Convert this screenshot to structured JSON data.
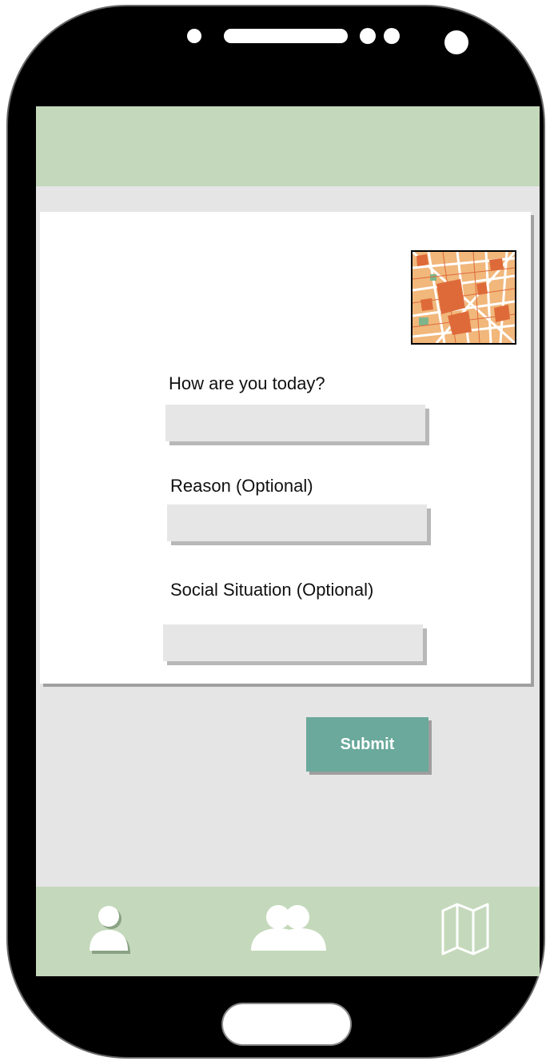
{
  "form": {
    "mood_label": "How are you today?",
    "mood_value": "",
    "reason_label": "Reason (Optional)",
    "reason_value": "",
    "social_label": "Social Situation (Optional)",
    "social_value": ""
  },
  "submit_label": "Submit",
  "nav": {
    "items": [
      {
        "icon": "person-icon"
      },
      {
        "icon": "group-icon"
      },
      {
        "icon": "map-icon"
      }
    ]
  },
  "colors": {
    "header": "#c4d9bb",
    "navbar": "#c4d9bb",
    "submit": "#6aa99b",
    "screen_bg": "#e5e5e5"
  }
}
